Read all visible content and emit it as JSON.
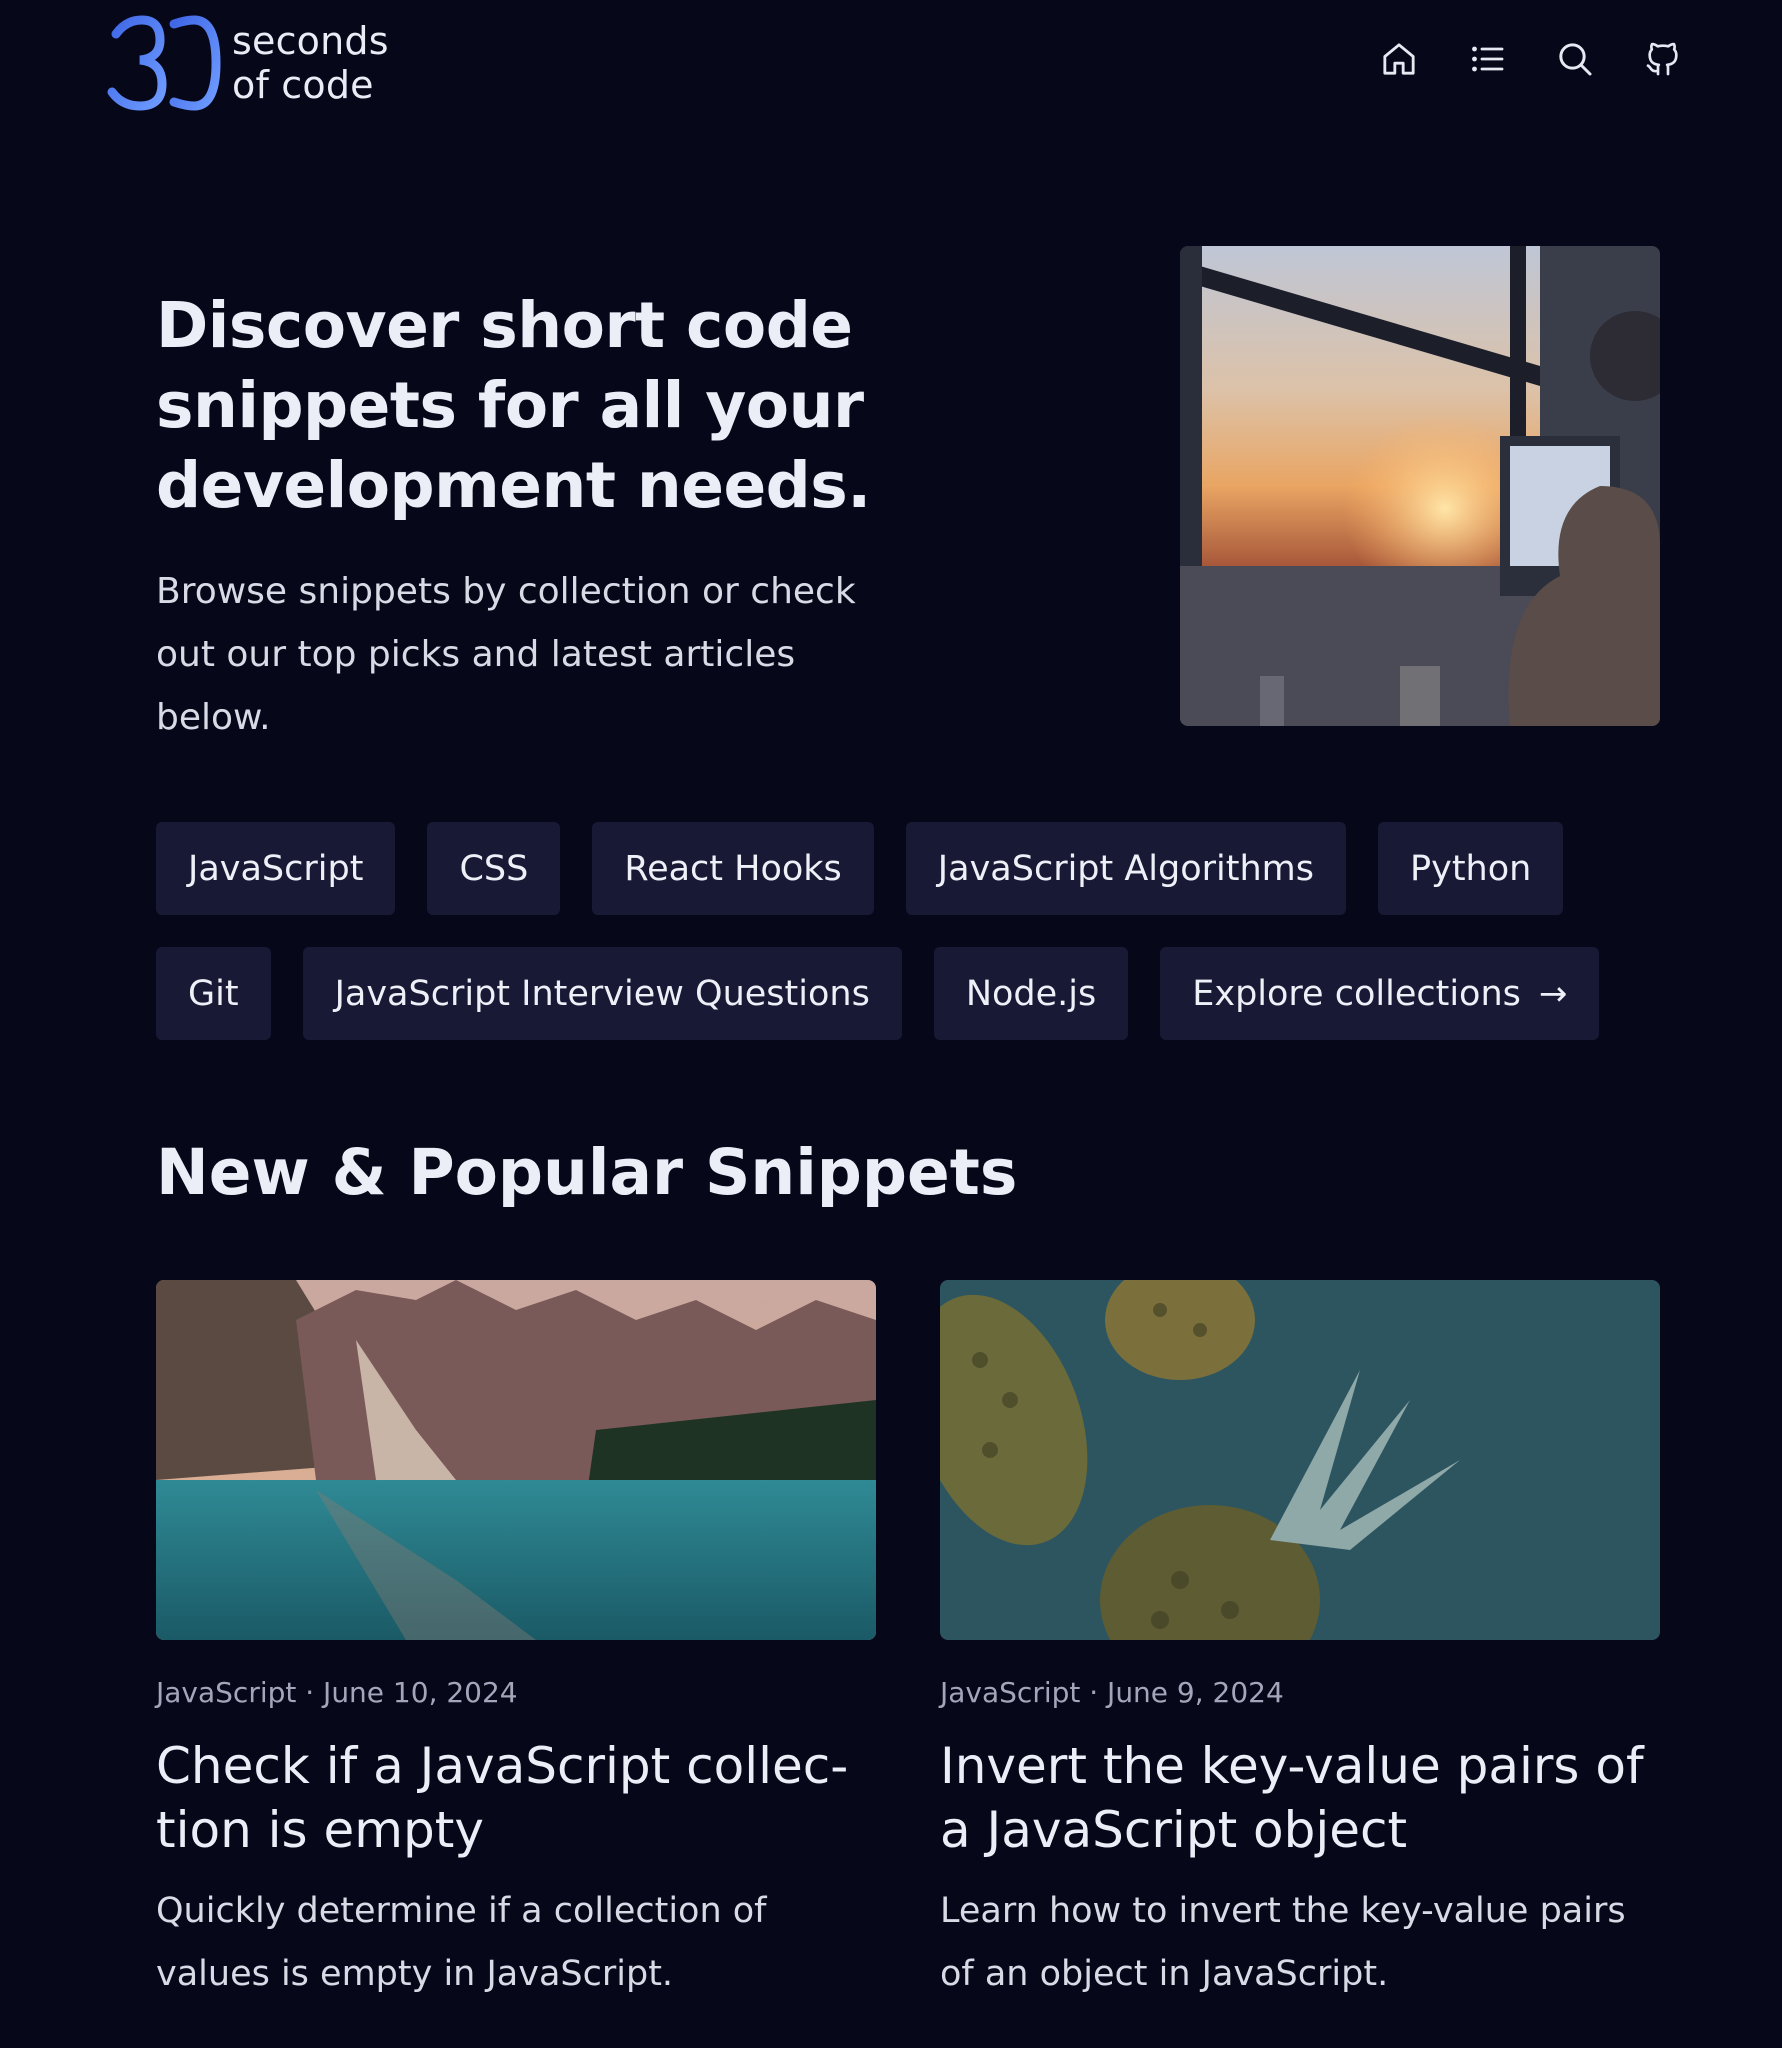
{
  "header": {
    "logo_line1": "seconds",
    "logo_line2": "of code",
    "nav": [
      "home-icon",
      "list-icon",
      "search-icon",
      "github-icon"
    ]
  },
  "hero": {
    "title": "Discover short code snippets for all your development needs.",
    "subtitle": "Browse snippets by collection or check out our top picks and latest articles below."
  },
  "collections": {
    "row1": [
      "JavaScript",
      "CSS",
      "React Hooks",
      "JavaScript Algorithms",
      "Python"
    ],
    "row2": [
      "Git",
      "JavaScript Interview Questions",
      "Node.js"
    ],
    "explore_label": "Explore collections",
    "explore_arrow": "→"
  },
  "section": {
    "title": "New & Popular Snippets"
  },
  "cards": [
    {
      "meta": "JavaScript · June 10, 2024",
      "title": "Check if a JavaScript collec-tion is empty",
      "description": "Quickly determine if a collection of values is empty in JavaScript."
    },
    {
      "meta": "JavaScript · June 9, 2024",
      "title": "Invert the key-value pairs of a JavaScript object",
      "description": "Learn how to invert the key-value pairs of an object in JavaScript."
    }
  ],
  "colors": {
    "background": "#07071a",
    "chip": "#181a35",
    "brand": "#4f7df3"
  }
}
